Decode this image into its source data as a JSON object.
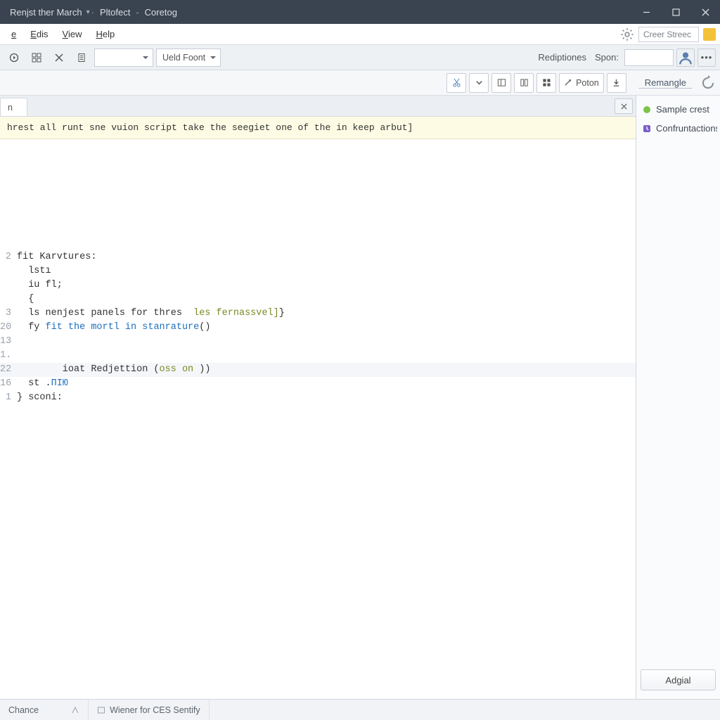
{
  "titlebar": {
    "seg1": "Renjst ther March",
    "seg2": "Pltofect",
    "seg3": "Coretog"
  },
  "menubar": {
    "file_pre": "",
    "file_u": "e",
    "file_post": "",
    "edit_pre": "",
    "edit_u": "E",
    "edit_post": "dis",
    "view_pre": "",
    "view_u": "V",
    "view_post": "iew",
    "help_pre": "",
    "help_u": "H",
    "help_post": "elp",
    "search_placeholder": "Creer Streec"
  },
  "toolbar": {
    "combo2": "Ueld Foont",
    "right_label1": "Rediptiones",
    "right_label2": "Spon:"
  },
  "toolbar2": {
    "poton": "Poton",
    "right_label": "Remangle"
  },
  "tabs": {
    "t0": "n"
  },
  "banner": "hrest all runt sne vuion script take the seegiet one of the in keep arbut]",
  "code": {
    "l1_g": "2",
    "l1": "fit Karvtures:",
    "l2_g": "",
    "l2": "  lstı",
    "l3_g": "",
    "l3": "  iu fl;",
    "l4_g": "",
    "l4": "",
    "l5_g": "",
    "l5": "",
    "l6_g": "",
    "l6": "  {",
    "l7_g": "3",
    "l7a": "  ls nenjest panels for thres  ",
    "l7b": "les fernassvel]",
    "l7c": "}",
    "l8_g": "20",
    "l8a": "  fy ",
    "l8b": "fit the mortl in stanrature",
    "l8c": "()",
    "l9_g": "13",
    "l9": "",
    "l10_g": "1.",
    "l10": "",
    "l11_g": "22",
    "l11a": "        ioat Redjettion (",
    "l11b": "oss on ",
    "l11c": "))",
    "l12_g": "16",
    "l12a": "  st .",
    "l12b": "ПIЮ",
    "l13_g": "1",
    "l13a": "} ",
    "l13b": "sconi:"
  },
  "side": {
    "item1": "Sample crest",
    "item2": "Confruntactions",
    "button": "Adgial"
  },
  "status": {
    "left": "Chance",
    "center": "Wiener for CES Sentify"
  }
}
